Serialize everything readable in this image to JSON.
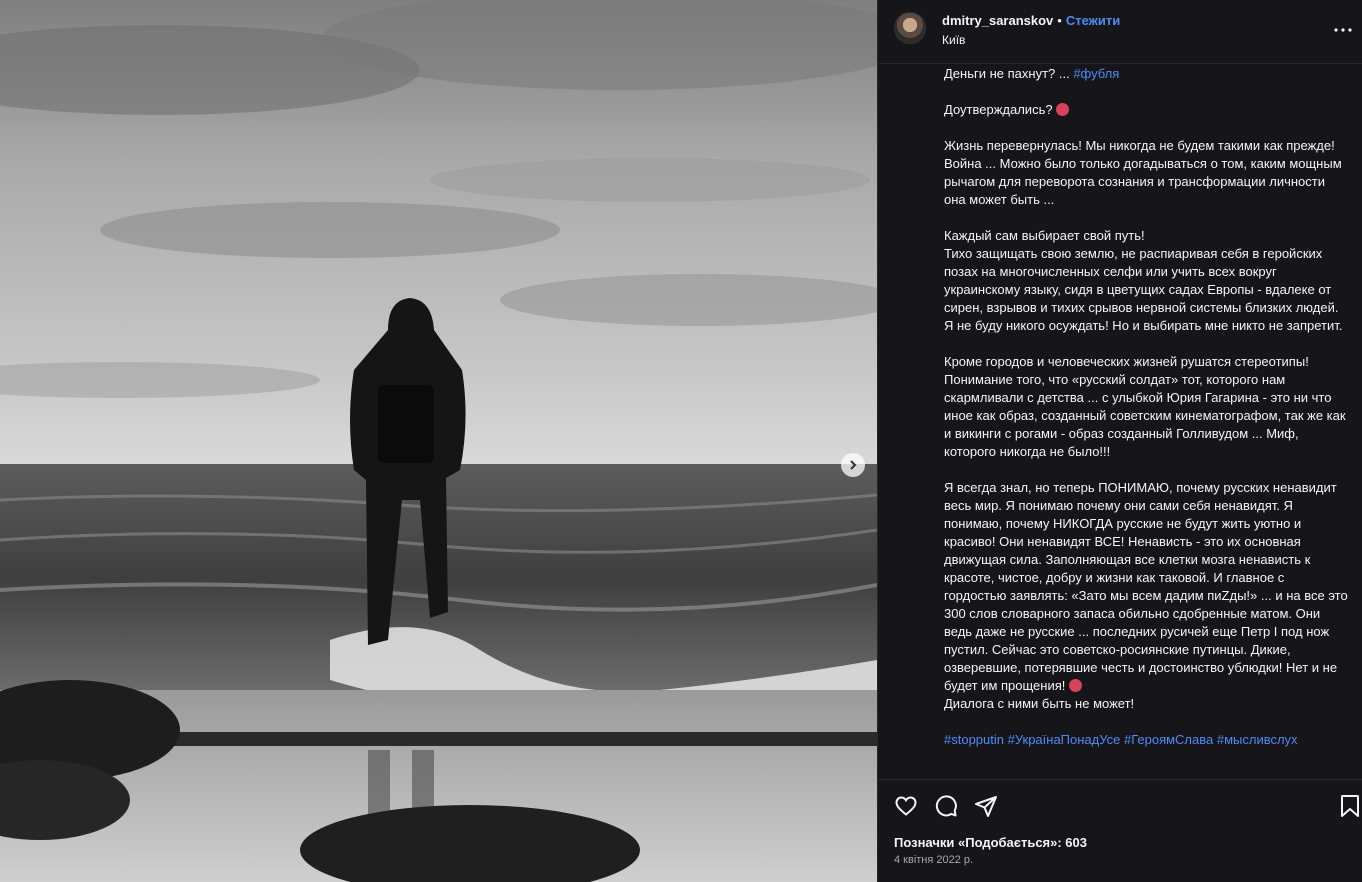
{
  "post": {
    "author": {
      "username": "dmitry_saranskov",
      "separator": "•",
      "follow_label": "Стежити",
      "location": "Київ"
    },
    "caption_lines": [
      "Деньги не пахнут? ... ",
      "#фубля",
      "Доутверждались?",
      "Жизнь перевернулась! Мы никогда не будем такими как прежде!\nВойна ... Можно было только догадываться о том, каким мощным рычагом для переворота сознания и трансформации личности она может быть ...",
      "Каждый сам выбирает свой путь!\nТихо защищать свою землю, не распиаривая себя в геройских позах на многочисленных селфи или учить всех вокруг украинскому языку, сидя в цветущих садах Европы - вдалеке от сирен, взрывов и тихих срывов нервной системы близких людей. Я не буду никого осуждать! Но и выбирать мне никто не запретит.",
      "Кроме городов и человеческих жизней рушатся стереотипы! Понимание того, что «русский солдат» тот, которого нам скармливали с детства ... с улыбкой Юрия Гагарина - это ни что иное как образ, созданный советским кинематографом, так же как и викинги с рогами - образ созданный Голливудом ... Миф, которого никогда не было!!!",
      "Я всегда знал, но теперь ПОНИМАЮ, почему русских ненавидит весь мир. Я понимаю почему они сами себя ненавидят. Я понимаю, почему НИКОГДА русские не будут жить уютно и красиво! Они ненавидят ВСЕ! Ненависть - это их основная движущая сила. Заполняющая все клетки мозга ненависть к красоте, чистое, добру и жизни как таковой. И главное с гордостью заявлять: «Зато мы всем дадим пиZды!» ... и на все это 300 слов словарного запаса обильно сдобренные матом. Они ведь даже не русские ... последних русичей еще Петр I под нож пустил. Сейчас это советско-росиянские путинцы. Дикие, озверевшие, потерявшие честь и достоинство ублюдки! Нет и не будет им прощения!",
      "Диалога с ними быть не может!",
      "#stopputin #УкраїнаПонадУсе #ГероямСлава #мысливслух"
    ],
    "likes_label": "Позначки «Подобається»: 603",
    "date": "4 квітня 2022 р.",
    "icons": {
      "more": "more-horizontal-icon",
      "like": "heart-icon",
      "comment": "comment-icon",
      "share": "send-icon",
      "save": "bookmark-icon",
      "next": "chevron-right-icon"
    },
    "colors": {
      "panel_bg": "#16161a",
      "link": "#4e8bf5",
      "text": "#f5f5f5",
      "muted": "#a8a8a8"
    }
  }
}
